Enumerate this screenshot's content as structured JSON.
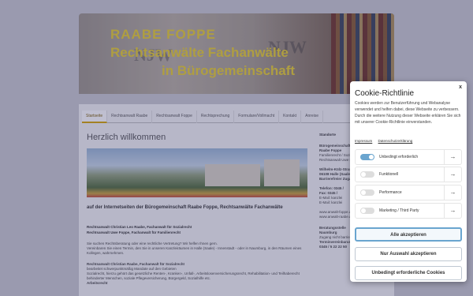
{
  "banner": {
    "line1": "RAABE  FOPPE",
    "line2": "Rechtsanwälte Fachanwälte",
    "line3": "in Bürogemeinschaft"
  },
  "nav": [
    "Startseite",
    "Rechtsanwalt Raabe",
    "Rechtsanwalt Foppe",
    "Rechtsprechung",
    "Formulare/Vollmacht",
    "Kontakt",
    "Anreise"
  ],
  "main": {
    "heading": "Herzlich willkommen",
    "intro": "auf der Internetseiten der Bürogemeinschaft Raabe Foppe, Rechtsanwälte Fachanwälte",
    "person1": "Rechtsanwalt Christian Leo Raabe, Fachanwalt für Sozialrecht",
    "person2": "Rechtsanwalt Uwe Foppe, Fachanwalt für Familienrecht",
    "para1": "Sie suchen Rechtsberatung oder eine rechtliche Vertretung? Wir helfen Ihnen gern.",
    "para2": "Vereinbaren Sie einen Termin, den Sie in unseren Kanzleiräumen in Halle (Saale) - Innenstadt - oder in Naumburg, in den Räumen eines Kollegen, wahrnehmen.",
    "para3": "Rechtsanwalt Christian Raabe, Fachanwalt für Sozialrecht",
    "para4": "bearbeitet schwerpunktmäßig Mandate auf den Gebieten",
    "para5": "Sozialrecht, hierzu gehört das gesetzliche Renten-, Kranken-, Unfall-, Arbeitslosenversicherungsrecht, Rehabilitation- und Teilhaberecht behinderter Menschen, soziale Pflegeversicherung, Bürgergeld, Sozialhilfe etc.",
    "para6": "Arbeitsrecht"
  },
  "side": {
    "heading": "Standorte",
    "block1": [
      "Bürogemeinschaft",
      "Raabe Foppe",
      "Familienrecht / Sozialrecht",
      "Rechtsanwalt Uwe Foppe"
    ],
    "block2": [
      "Wilhelm-Külz-Straße",
      "06108 Halle (Saale)",
      "Barrierefreier Zugang"
    ],
    "block3": [
      "Telefon: 0345 /",
      "Fax:        0345 /",
      "E-Mail: kanzlei",
      "E-Mail: kanzlei"
    ],
    "block4": [
      "www.anwalt-foppe.de",
      "www.anwalt-raabe.de"
    ],
    "block5": [
      "Beratungsstelle",
      "Naumburg",
      "Zugang nicht barrierefrei",
      "Terminvereinbarung",
      "0345 / 5 22 22 50"
    ]
  },
  "cookie": {
    "close": "x",
    "title": "Cookie-Richtlinie",
    "text": "Cookies werden zur Benutzerführung und Webanalyse verwendet und helfen dabei, diese Webseite zu verbessern. Durch die weitere Nutzung dieser Webseite erklären Sie sich mit unserer Cookie-Richtlinie einverstanden.",
    "link_impressum": "Impressum",
    "link_datenschutz": "Datenschutzerklärung",
    "options": [
      {
        "label": "Unbedingt erforderlich",
        "on": true
      },
      {
        "label": "Funktionell",
        "on": false
      },
      {
        "label": "Performance",
        "on": false
      },
      {
        "label": "Marketing / Third Party",
        "on": false
      }
    ],
    "btn_all": "Alle akzeptieren",
    "btn_selection": "Nur Auswahl akzeptieren",
    "btn_required": "Unbedingt erforderliche Cookies"
  }
}
